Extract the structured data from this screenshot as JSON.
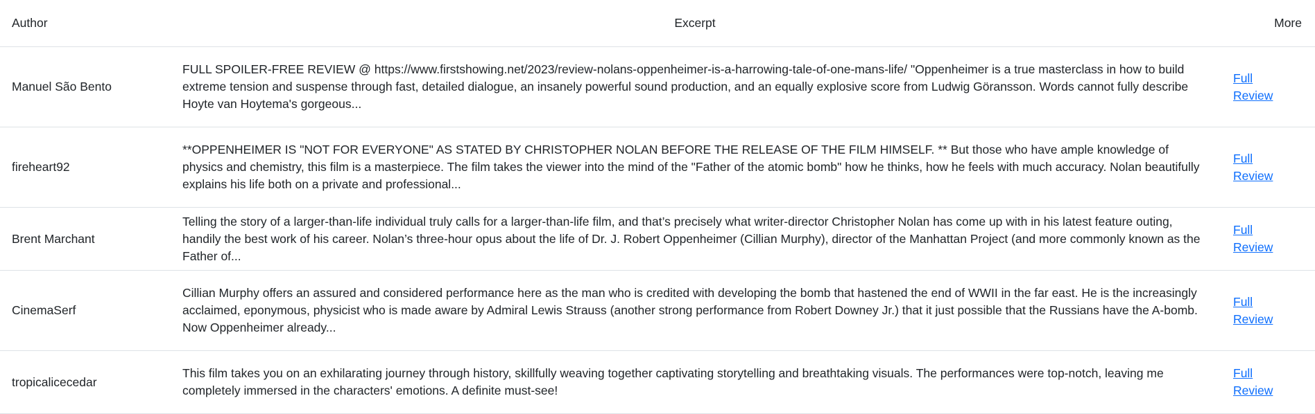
{
  "table": {
    "headers": {
      "author": "Author",
      "excerpt": "Excerpt",
      "more": "More"
    },
    "rows": [
      {
        "author": "Manuel São Bento",
        "excerpt": "FULL SPOILER-FREE REVIEW @ https://www.firstshowing.net/2023/review-nolans-oppenheimer-is-a-harrowing-tale-of-one-mans-life/ \"Oppenheimer is a true masterclass in how to build extreme tension and suspense through fast, detailed dialogue, an insanely powerful sound production, and an equally explosive score from Ludwig Göransson. Words cannot fully describe Hoyte van Hoytema's gorgeous...",
        "link": "Full Review"
      },
      {
        "author": "fireheart92",
        "excerpt": "**OPPENHEIMER IS \"NOT FOR EVERYONE\" AS STATED BY CHRISTOPHER NOLAN BEFORE THE RELEASE OF THE FILM HIMSELF. ** But those who have ample knowledge of physics and chemistry, this film is a masterpiece. The film takes the viewer into the mind of the \"Father of the atomic bomb\" how he thinks, how he feels with much accuracy. Nolan beautifully explains his life both on a private and professional...",
        "link": "Full Review"
      },
      {
        "author": "Brent Marchant",
        "excerpt": "Telling the story of a larger-than-life individual truly calls for a larger-than-life film, and that’s precisely what writer-director Christopher Nolan has come up with in his latest feature outing, handily the best work of his career. Nolan’s three-hour opus about the life of Dr. J. Robert Oppenheimer (Cillian Murphy), director of the Manhattan Project (and more commonly known as the Father of...",
        "link": "Full Review"
      },
      {
        "author": "CinemaSerf",
        "excerpt": "Cillian Murphy offers an assured and considered performance here as the man who is credited with developing the bomb that hastened the end of WWII in the far east. He is the increasingly acclaimed, eponymous, physicist who is made aware by Admiral Lewis Strauss (another strong performance from Robert Downey Jr.) that it just possible that the Russians have the A-bomb. Now Oppenheimer already...",
        "link": "Full Review"
      },
      {
        "author": "tropicalicecedar",
        "excerpt": "This film takes you on an exhilarating journey through history, skillfully weaving together captivating storytelling and breathtaking visuals. The performances were top-notch, leaving me completely immersed in the characters' emotions. A definite must-see!",
        "link": "Full Review"
      }
    ]
  },
  "colors": {
    "link": "#0d6efd",
    "text": "#212529",
    "border": "#dee2e6"
  }
}
